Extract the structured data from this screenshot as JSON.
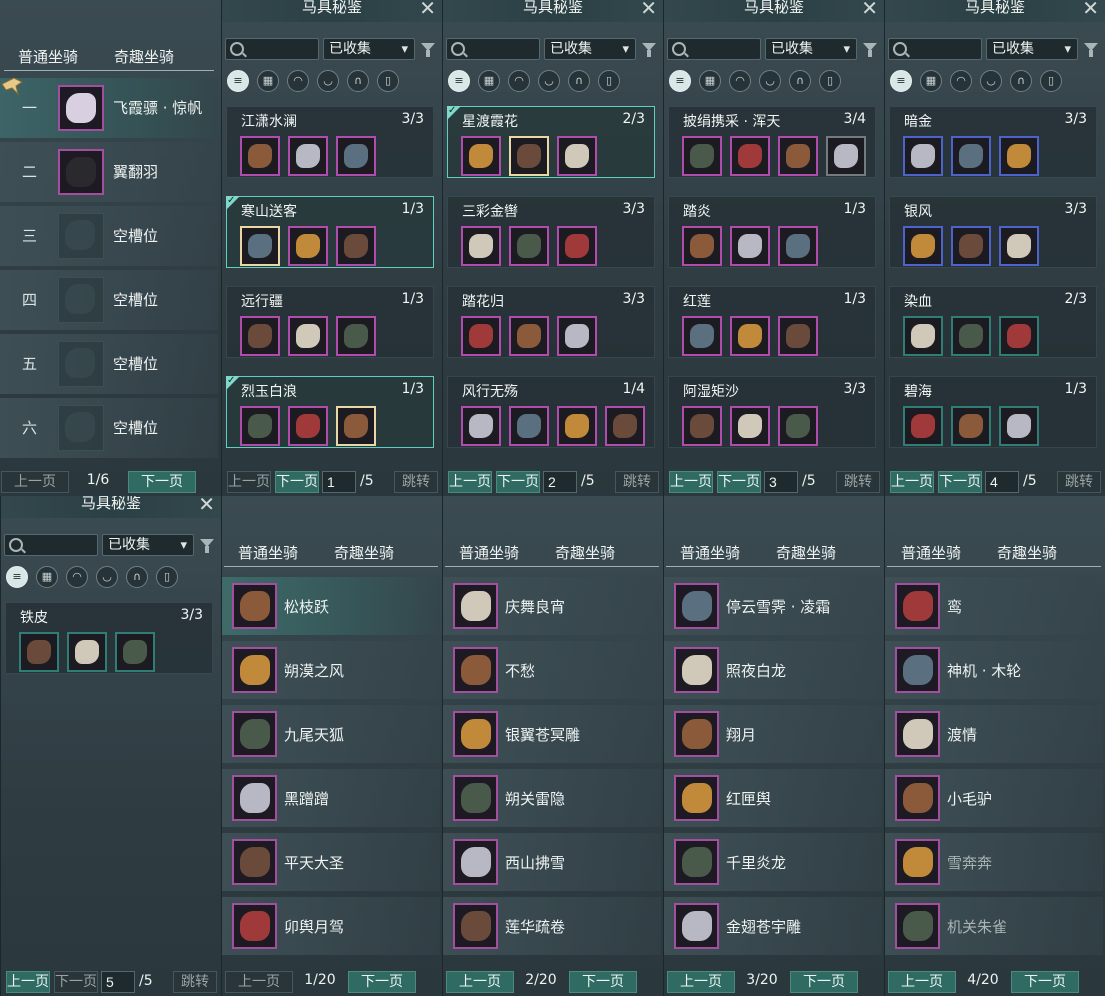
{
  "panels": {
    "title": "马具秘鉴",
    "close_label": "✕",
    "filter_value": "已收集",
    "icons": [
      "list-icon",
      "grid-icon",
      "saddle-icon",
      "armor-icon",
      "horseshoe-icon",
      "tag-icon"
    ],
    "prev_label": "上一页",
    "next_label": "下一页",
    "jump_label": "跳转",
    "total_label": "/5",
    "pages": [
      {
        "page": "1",
        "cards": [
          {
            "name": "江潇水澜",
            "count": "3/3",
            "selected": false,
            "checked": false,
            "items": [
              "purple",
              "purple",
              "purple"
            ]
          },
          {
            "name": "寒山送客",
            "count": "1/3",
            "selected": true,
            "checked": true,
            "items": [
              "gold",
              "purple",
              "purple"
            ]
          },
          {
            "name": "远行疆",
            "count": "1/3",
            "selected": false,
            "checked": false,
            "items": [
              "purple",
              "purple",
              "purple"
            ]
          },
          {
            "name": "烈玉白浪",
            "count": "1/3",
            "selected": true,
            "checked": true,
            "items": [
              "purple",
              "purple",
              "gold"
            ]
          }
        ]
      },
      {
        "page": "2",
        "cards": [
          {
            "name": "星渡霞花",
            "count": "2/3",
            "selected": true,
            "checked": true,
            "items": [
              "purple",
              "gold",
              "purple"
            ]
          },
          {
            "name": "三彩金辔",
            "count": "3/3",
            "selected": false,
            "checked": false,
            "items": [
              "purple",
              "purple",
              "purple"
            ]
          },
          {
            "name": "踏花归",
            "count": "3/3",
            "selected": false,
            "checked": false,
            "items": [
              "purple",
              "purple",
              "purple"
            ]
          },
          {
            "name": "风行无殇",
            "count": "1/4",
            "selected": false,
            "checked": false,
            "items": [
              "purple",
              "purple",
              "purple",
              "purple"
            ]
          }
        ]
      },
      {
        "page": "3",
        "cards": [
          {
            "name": "披绢携采 · 浑天",
            "count": "3/4",
            "selected": false,
            "checked": false,
            "items": [
              "purple",
              "purple",
              "purple",
              "grey"
            ]
          },
          {
            "name": "踏炎",
            "count": "1/3",
            "selected": false,
            "checked": false,
            "items": [
              "purple",
              "purple",
              "purple"
            ]
          },
          {
            "name": "红莲",
            "count": "1/3",
            "selected": false,
            "checked": false,
            "items": [
              "purple",
              "purple",
              "purple"
            ]
          },
          {
            "name": "阿湿矩沙",
            "count": "3/3",
            "selected": false,
            "checked": false,
            "items": [
              "purple",
              "purple",
              "purple"
            ]
          }
        ]
      },
      {
        "page": "4",
        "cards": [
          {
            "name": "暗金",
            "count": "3/3",
            "selected": false,
            "checked": false,
            "items": [
              "blue",
              "blue",
              "blue"
            ]
          },
          {
            "name": "银风",
            "count": "3/3",
            "selected": false,
            "checked": false,
            "items": [
              "blue",
              "blue",
              "blue"
            ]
          },
          {
            "name": "染血",
            "count": "2/3",
            "selected": false,
            "checked": false,
            "items": [
              "teal",
              "teal",
              "teal"
            ]
          },
          {
            "name": "碧海",
            "count": "1/3",
            "selected": false,
            "checked": false,
            "items": [
              "teal",
              "teal",
              "teal"
            ]
          }
        ]
      },
      {
        "page": "5",
        "cards": [
          {
            "name": "铁皮",
            "count": "3/3",
            "selected": false,
            "checked": false,
            "items": [
              "teal",
              "teal",
              "teal"
            ]
          }
        ]
      }
    ]
  },
  "mounts": {
    "tab_normal": "普通坐骑",
    "tab_fun": "奇趣坐骑",
    "prev_label": "上一页",
    "next_label": "下一页",
    "slots": [
      {
        "num": "一",
        "name": "飞霞骠 · 惊帆",
        "filled": true
      },
      {
        "num": "二",
        "name": "翼翻羽",
        "filled": true
      },
      {
        "num": "三",
        "name": "空槽位",
        "filled": false
      },
      {
        "num": "四",
        "name": "空槽位",
        "filled": false
      },
      {
        "num": "五",
        "name": "空槽位",
        "filled": false
      },
      {
        "num": "六",
        "name": "空槽位",
        "filled": false
      }
    ],
    "slot_page": "1/6",
    "lists": [
      {
        "page": "1/20",
        "items": [
          "松枝跃",
          "朔漠之风",
          "九尾天狐",
          "黑蹭蹭",
          "平天大圣",
          "卯舆月驾"
        ]
      },
      {
        "page": "2/20",
        "items": [
          "庆舞良宵",
          "不愁",
          "银翼苍冥雕",
          "朔关雷隐",
          "西山拂雪",
          "莲华疏卷"
        ]
      },
      {
        "page": "3/20",
        "items": [
          "停云雪霁 · 凌霜",
          "照夜白龙",
          "翔月",
          "红匣舆",
          "千里炎龙",
          "金翅苍宇雕"
        ]
      },
      {
        "page": "4/20",
        "items": [
          "鸾",
          "神机 · 木轮",
          "渡情",
          "小毛驴",
          "雪奔奔",
          "机关朱雀"
        ]
      }
    ]
  },
  "colors": {
    "accent": "#2f6b63",
    "selected_border": "#5fd0c0",
    "purple": "#b04cab",
    "gold": "#e9d7a6",
    "blue": "#4c63c9",
    "teal": "#2f7d74"
  }
}
